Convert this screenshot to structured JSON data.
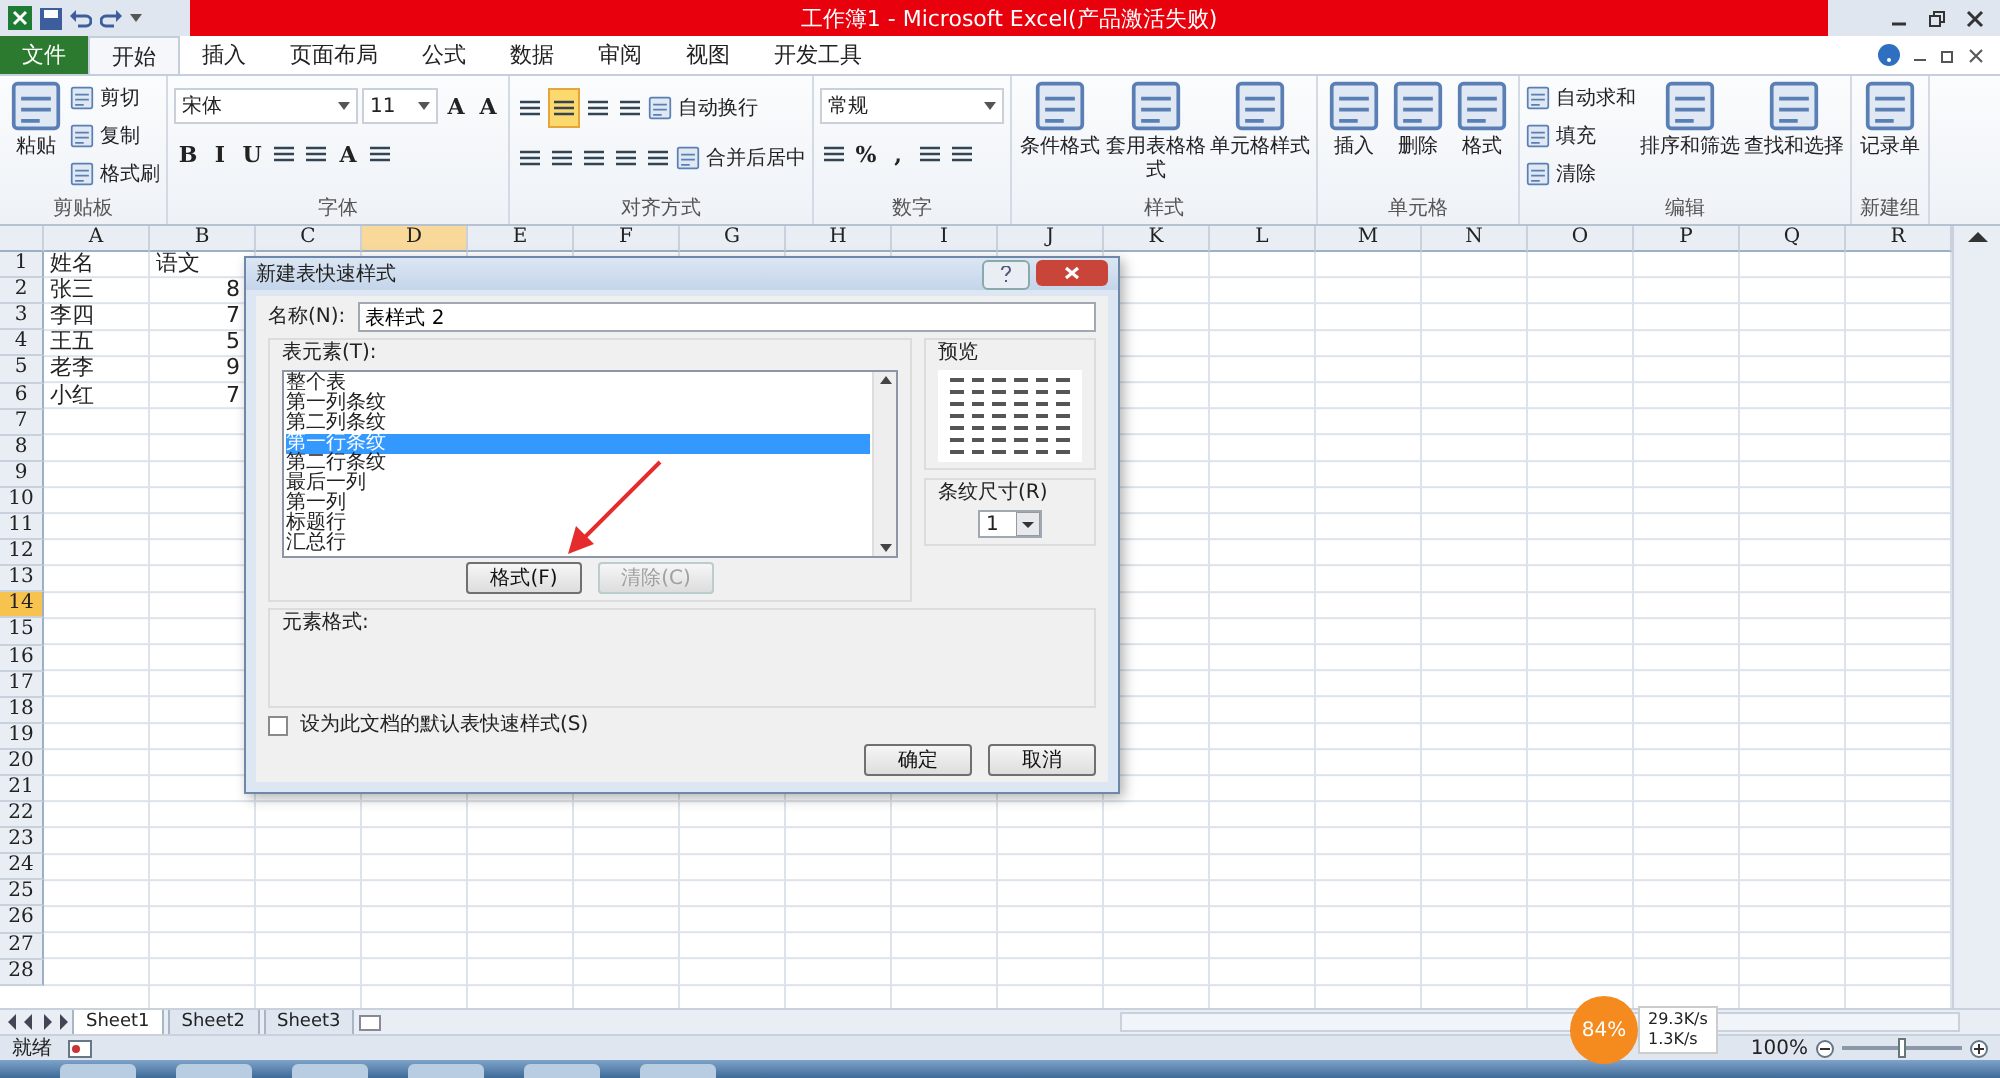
{
  "window": {
    "title": "工作簿1 - Microsoft Excel(产品激活失败)"
  },
  "ribbon_tabs": [
    {
      "label": "文件",
      "kind": "file",
      "selected": false
    },
    {
      "label": "开始",
      "kind": "tab",
      "selected": true
    },
    {
      "label": "插入",
      "kind": "tab",
      "selected": false
    },
    {
      "label": "页面布局",
      "kind": "tab",
      "selected": false
    },
    {
      "label": "公式",
      "kind": "tab",
      "selected": false
    },
    {
      "label": "数据",
      "kind": "tab",
      "selected": false
    },
    {
      "label": "审阅",
      "kind": "tab",
      "selected": false
    },
    {
      "label": "视图",
      "kind": "tab",
      "selected": false
    },
    {
      "label": "开发工具",
      "kind": "tab",
      "selected": false
    }
  ],
  "ribbon_groups": [
    {
      "label": "剪贴板",
      "kind": "columns",
      "items": [
        {
          "kind": "large",
          "label": "粘贴"
        },
        {
          "kind": "small",
          "label": "剪切"
        },
        {
          "kind": "small",
          "label": "复制"
        },
        {
          "kind": "small",
          "label": "格式刷"
        }
      ]
    },
    {
      "label": "字体",
      "kind": "lines",
      "lines": [
        {
          "items": [
            {
              "kind": "wide_field",
              "value": "宋体"
            },
            {
              "kind": "field",
              "value": "11"
            },
            {
              "kind": "glyph",
              "label": "A"
            },
            {
              "kind": "glyph",
              "label": "A"
            }
          ]
        },
        {
          "items": [
            {
              "kind": "glyph",
              "label": "B"
            },
            {
              "kind": "glyph",
              "label": "I"
            },
            {
              "kind": "glyph",
              "label": "U"
            },
            {
              "kind": "icon"
            },
            {
              "kind": "icon"
            },
            {
              "kind": "glyph",
              "label": "A"
            },
            {
              "kind": "icon"
            }
          ]
        }
      ]
    },
    {
      "label": "对齐方式",
      "kind": "lines",
      "lines": [
        {
          "items": [
            {
              "kind": "icon"
            },
            {
              "kind": "icon",
              "selected": true
            },
            {
              "kind": "icon"
            },
            {
              "kind": "icon"
            },
            {
              "kind": "small",
              "label": "自动换行"
            }
          ]
        },
        {
          "items": [
            {
              "kind": "icon"
            },
            {
              "kind": "icon"
            },
            {
              "kind": "icon"
            },
            {
              "kind": "icon"
            },
            {
              "kind": "icon"
            },
            {
              "kind": "small",
              "label": "合并后居中"
            }
          ]
        }
      ]
    },
    {
      "label": "数字",
      "kind": "lines",
      "lines": [
        {
          "items": [
            {
              "kind": "wide_field",
              "value": "常规"
            }
          ]
        },
        {
          "items": [
            {
              "kind": "icon"
            },
            {
              "kind": "glyph",
              "label": "%"
            },
            {
              "kind": "glyph",
              "label": ","
            },
            {
              "kind": "icon"
            },
            {
              "kind": "icon"
            }
          ]
        }
      ]
    },
    {
      "label": "样式",
      "kind": "columns",
      "items": [
        {
          "kind": "large",
          "label": "条件格式"
        },
        {
          "kind": "large",
          "label": "套用表格格式"
        },
        {
          "kind": "large",
          "label": "单元格样式"
        }
      ]
    },
    {
      "label": "单元格",
      "kind": "columns",
      "items": [
        {
          "kind": "large",
          "label": "插入"
        },
        {
          "kind": "large",
          "label": "删除"
        },
        {
          "kind": "large",
          "label": "格式"
        }
      ]
    },
    {
      "label": "编辑",
      "kind": "columns",
      "items": [
        {
          "kind": "small",
          "label": "自动求和"
        },
        {
          "kind": "small",
          "label": "填充"
        },
        {
          "kind": "small",
          "label": "清除"
        },
        {
          "kind": "large",
          "label": "排序和筛选"
        },
        {
          "kind": "large",
          "label": "查找和选择"
        }
      ]
    },
    {
      "label": "新建组",
      "kind": "columns",
      "items": [
        {
          "kind": "large",
          "label": "记录单"
        }
      ]
    }
  ],
  "sheet": {
    "columns": [
      {
        "label": "A",
        "selected": false
      },
      {
        "label": "B",
        "selected": false
      },
      {
        "label": "C",
        "selected": false
      },
      {
        "label": "D",
        "selected": true
      },
      {
        "label": "E",
        "selected": false
      },
      {
        "label": "F",
        "selected": false
      },
      {
        "label": "G",
        "selected": false
      },
      {
        "label": "H",
        "selected": false
      },
      {
        "label": "I",
        "selected": false
      },
      {
        "label": "J",
        "selected": false
      },
      {
        "label": "K",
        "selected": false
      },
      {
        "label": "L",
        "selected": false
      },
      {
        "label": "M",
        "selected": false
      },
      {
        "label": "N",
        "selected": false
      },
      {
        "label": "O",
        "selected": false
      },
      {
        "label": "P",
        "selected": false
      },
      {
        "label": "Q",
        "selected": false
      },
      {
        "label": "R",
        "selected": false
      }
    ],
    "rows": [
      {
        "label": "1",
        "selected": false,
        "cells": [
          "姓名",
          "语文"
        ]
      },
      {
        "label": "2",
        "selected": false,
        "cells": [
          "张三",
          "8"
        ]
      },
      {
        "label": "3",
        "selected": false,
        "cells": [
          "李四",
          "7"
        ]
      },
      {
        "label": "4",
        "selected": false,
        "cells": [
          "王五",
          "5"
        ]
      },
      {
        "label": "5",
        "selected": false,
        "cells": [
          "老李",
          "9"
        ]
      },
      {
        "label": "6",
        "selected": false,
        "cells": [
          "小红",
          "7"
        ]
      },
      {
        "label": "7",
        "selected": false,
        "cells": []
      },
      {
        "label": "8",
        "selected": false,
        "cells": []
      },
      {
        "label": "9",
        "selected": false,
        "cells": []
      },
      {
        "label": "10",
        "selected": false,
        "cells": []
      },
      {
        "label": "11",
        "selected": false,
        "cells": []
      },
      {
        "label": "12",
        "selected": false,
        "cells": []
      },
      {
        "label": "13",
        "selected": false,
        "cells": []
      },
      {
        "label": "14",
        "selected": true,
        "cells": []
      },
      {
        "label": "15",
        "selected": false,
        "cells": []
      },
      {
        "label": "16",
        "selected": false,
        "cells": []
      },
      {
        "label": "17",
        "selected": false,
        "cells": []
      },
      {
        "label": "18",
        "selected": false,
        "cells": []
      },
      {
        "label": "19",
        "selected": false,
        "cells": []
      },
      {
        "label": "20",
        "selected": false,
        "cells": []
      },
      {
        "label": "21",
        "selected": false,
        "cells": []
      },
      {
        "label": "22",
        "selected": false,
        "cells": []
      },
      {
        "label": "23",
        "selected": false,
        "cells": []
      },
      {
        "label": "24",
        "selected": false,
        "cells": []
      },
      {
        "label": "25",
        "selected": false,
        "cells": []
      },
      {
        "label": "26",
        "selected": false,
        "cells": []
      },
      {
        "label": "27",
        "selected": false,
        "cells": []
      },
      {
        "label": "28",
        "selected": false,
        "cells": []
      }
    ]
  },
  "sheet_tabs": [
    {
      "label": "Sheet1",
      "selected": true
    },
    {
      "label": "Sheet2",
      "selected": false
    },
    {
      "label": "Sheet3",
      "selected": false
    }
  ],
  "status_bar": {
    "status": "就绪",
    "zoom": "100%",
    "zoom_slider": {
      "level": 0.5
    }
  },
  "speed_widget": {
    "percent": "84%",
    "upload": "29.3K/s",
    "download": "1.3K/s"
  },
  "dialog": {
    "title": "新建表快速样式",
    "name_label": "名称(N):",
    "name_value": "表样式 2",
    "elements_label": "表元素(T):",
    "elements": [
      {
        "label": "整个表",
        "selected": false
      },
      {
        "label": "第一列条纹",
        "selected": false
      },
      {
        "label": "第二列条纹",
        "selected": false
      },
      {
        "label": "第一行条纹",
        "selected": true
      },
      {
        "label": "第二行条纹",
        "selected": false
      },
      {
        "label": "最后一列",
        "selected": false
      },
      {
        "label": "第一列",
        "selected": false
      },
      {
        "label": "标题行",
        "selected": false
      },
      {
        "label": "汇总行",
        "selected": false
      }
    ],
    "format_button": {
      "label": "格式(F)",
      "disabled": false
    },
    "clear_button": {
      "label": "清除(C)",
      "disabled": true
    },
    "preview_label": "预览",
    "stripe_label": "条纹尺寸(R)",
    "stripe_value": "1",
    "element_format_label": "元素格式:",
    "default_checkbox": {
      "label": "设为此文档的默认表快速样式(S)",
      "checked": false
    },
    "ok": "确定",
    "cancel": "取消"
  }
}
